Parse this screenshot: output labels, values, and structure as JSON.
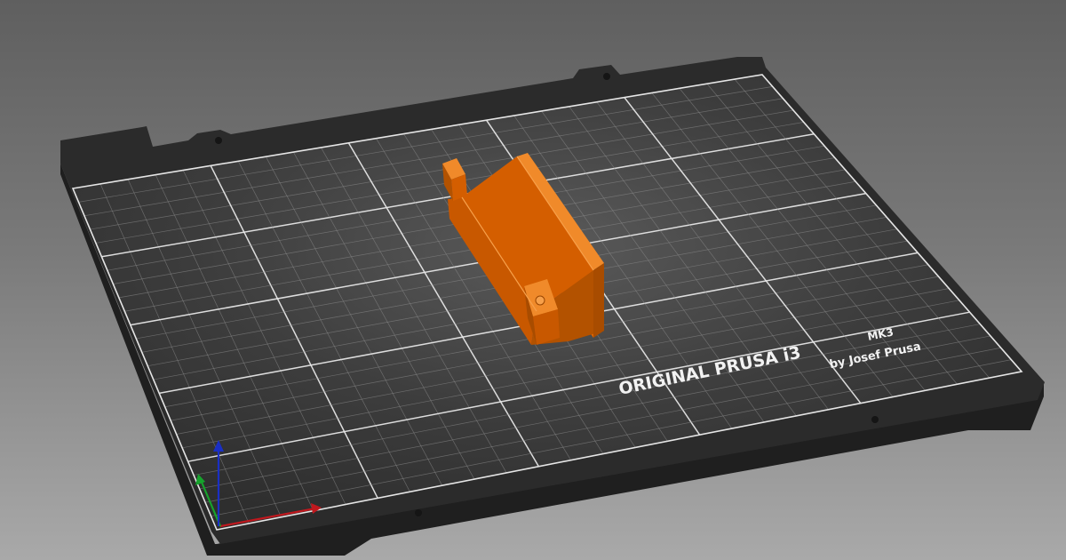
{
  "viewport": {
    "background_top": "#5f5f5f",
    "background_bottom": "#a9a9a9"
  },
  "bed": {
    "plate_color": "#2a2a2a",
    "plate_edge_color": "#1c1c1c",
    "sheet_color": "#3a3a3a",
    "grid_minor_color": "#8a8a8a",
    "grid_major_color": "#e6e6e6",
    "brand": {
      "line1": "ORIGINAL PRUSA i3",
      "model": "MK3",
      "line2": "by Josef Prusa"
    }
  },
  "model": {
    "name": "bracket-part",
    "color": "#e86a00",
    "shade_color": "#b35200",
    "light_color": "#f08a2a"
  },
  "axes": {
    "x_color": "#c0181e",
    "y_color": "#16a32c",
    "z_color": "#1a2fc4",
    "icon_names": [
      "x-axis-arrow",
      "y-axis-arrow",
      "z-axis-arrow"
    ]
  }
}
